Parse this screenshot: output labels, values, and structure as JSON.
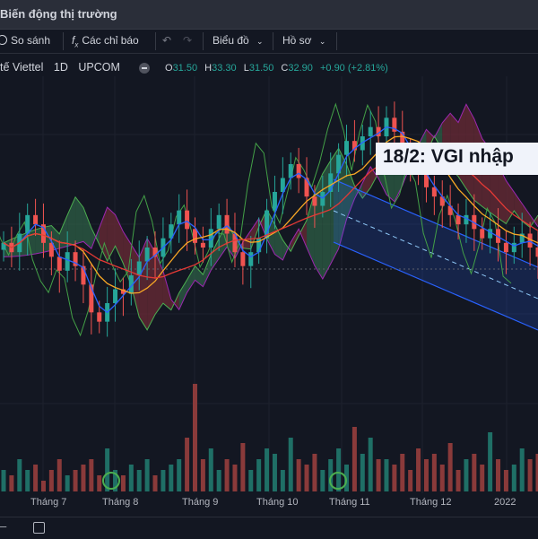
{
  "title": "Biến động thị trường",
  "toolbar": {
    "compare": "So sánh",
    "indicators": "Các chỉ báo",
    "chart_type": "Biểu đồ",
    "profile": "Hồ sơ"
  },
  "symbol": {
    "name": "tế Viettel",
    "interval": "1D",
    "exchange": "UPCOM"
  },
  "ohlc": {
    "o_label": "O",
    "o": "31.50",
    "h_label": "H",
    "h": "33.30",
    "l_label": "L",
    "l": "31.50",
    "c_label": "C",
    "c": "32.90",
    "change": "+0.90 (+2.81%)"
  },
  "annotation": "18/2: VGI nhập",
  "colors": {
    "up": "#26a69a",
    "down": "#ef5350",
    "ma_fast": "#2962ff",
    "ma_slow": "#f9a825",
    "ma_red": "#e53935",
    "cloud_green": "#2e5f45",
    "cloud_red": "#6b2b35",
    "channel": "#2962ff",
    "lagging": "#43a047"
  },
  "chart_data": {
    "type": "candlestick",
    "x_ticks": [
      "Tháng 7",
      "Tháng 8",
      "Tháng 9",
      "Tháng 10",
      "Tháng 11",
      "Tháng 12",
      "2022"
    ],
    "y_range_estimate": [
      24,
      36
    ],
    "close_series": [
      29.0,
      28.6,
      29.4,
      30.2,
      29.8,
      29.0,
      28.4,
      27.8,
      28.6,
      28.0,
      27.2,
      26.0,
      25.6,
      26.4,
      27.0,
      26.8,
      27.6,
      28.2,
      28.8,
      28.4,
      29.2,
      29.8,
      30.4,
      29.6,
      29.0,
      28.8,
      29.6,
      30.2,
      29.4,
      28.6,
      28.0,
      28.6,
      29.2,
      30.4,
      31.2,
      31.8,
      32.4,
      31.8,
      31.0,
      30.6,
      31.2,
      32.0,
      32.8,
      33.4,
      33.0,
      33.6,
      34.0,
      33.6,
      34.4,
      33.8,
      33.0,
      32.6,
      32.0,
      31.4,
      31.0,
      30.6,
      30.2,
      29.8,
      30.2,
      29.6,
      29.2,
      29.6,
      29.0,
      28.6,
      29.0,
      29.4,
      28.8,
      28.4
    ],
    "volume_relative": [
      0.2,
      0.15,
      0.3,
      0.2,
      0.25,
      0.1,
      0.2,
      0.3,
      0.15,
      0.2,
      0.25,
      0.3,
      0.15,
      0.4,
      0.2,
      0.15,
      0.25,
      0.2,
      0.3,
      0.15,
      0.2,
      0.25,
      0.3,
      0.5,
      1.0,
      0.3,
      0.4,
      0.2,
      0.3,
      0.25,
      0.45,
      0.2,
      0.3,
      0.4,
      0.35,
      0.2,
      0.5,
      0.3,
      0.25,
      0.35,
      0.2,
      0.3,
      0.4,
      0.25,
      0.6,
      0.35,
      0.5,
      0.3,
      0.3,
      0.25,
      0.35,
      0.2,
      0.4,
      0.3,
      0.35,
      0.25,
      0.45,
      0.2,
      0.3,
      0.35,
      0.25,
      0.55,
      0.3,
      0.2,
      0.25,
      0.4,
      0.3,
      0.35
    ],
    "markers": [
      {
        "label": "signal",
        "x_tick_index": 1
      },
      {
        "label": "signal",
        "x_tick_index": 4
      }
    ]
  }
}
